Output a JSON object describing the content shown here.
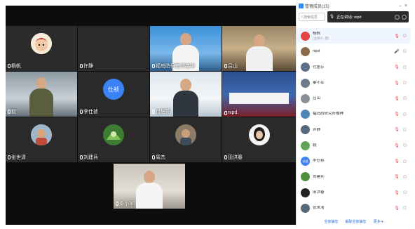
{
  "panel": {
    "title": "管理成员(15)",
    "search_placeholder": "搜索成员",
    "speaking_text": "正在讲话: nipd",
    "footer": {
      "mute_all": "全体静音",
      "unmute_all": "解除全体静音",
      "more": "更多 ▾"
    },
    "participants": [
      {
        "name": "杨帆",
        "sub": "(主持人, 我)",
        "mic": "off",
        "cam": "off",
        "avatar_color": "#e54545"
      },
      {
        "name": "nipd",
        "mic": "on",
        "cam": "off",
        "avatar_color": "#8a6a4a"
      },
      {
        "name": "付居芬",
        "mic": "off",
        "cam": "off",
        "avatar_color": "#5b6f8a"
      },
      {
        "name": "秦小军",
        "mic": "off",
        "cam": "off",
        "avatar_color": "#6d7b8c"
      },
      {
        "name": "吕山",
        "mic": "off",
        "cam": "off",
        "avatar_color": "#8a8f96"
      },
      {
        "name": "福岛防研究所楼神",
        "mic": "off",
        "cam": "off",
        "avatar_color": "#4a86b8"
      },
      {
        "name": "许静",
        "mic": "off",
        "cam": "off",
        "avatar_color": "#556a83"
      },
      {
        "name": "毅",
        "mic": "off",
        "cam": "off",
        "avatar_color": "#62a35a"
      },
      {
        "name": "李仕祯",
        "mic": "off",
        "cam": "off",
        "avatar_color": "#3b82f6",
        "avatar_text": "仕祯"
      },
      {
        "name": "刘建兵",
        "mic": "off",
        "cam": "off",
        "avatar_color": "#4d8f3a"
      },
      {
        "name": "田洪春",
        "mic": "off",
        "cam": "off",
        "avatar_color": "#222222"
      },
      {
        "name": "张世清",
        "mic": "off",
        "cam": "off",
        "avatar_color": "#556b7d"
      }
    ]
  },
  "video": {
    "tiles": [
      {
        "label": "杨帆"
      },
      {
        "label": "许静"
      },
      {
        "label": "福岛防研究所楼神"
      },
      {
        "label": "吕山"
      },
      {
        "label": "毅"
      },
      {
        "label": "李仕祯",
        "avatar_text": "仕祯"
      },
      {
        "label": "付居芬"
      },
      {
        "label": "nipd"
      },
      {
        "label": "张世清"
      },
      {
        "label": "刘建兵"
      },
      {
        "label": "周杰"
      },
      {
        "label": "田洪春"
      },
      {
        "label": "秦小军"
      }
    ]
  }
}
